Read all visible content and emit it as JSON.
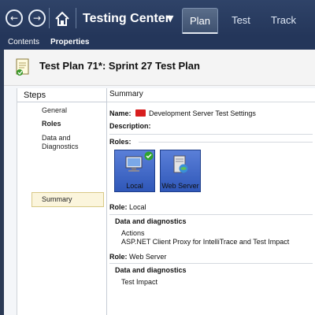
{
  "nav": {
    "back_icon": "back-arrow-icon",
    "forward_icon": "forward-arrow-icon",
    "home_icon": "home-icon",
    "app_title": "Testing Center",
    "dropdown_glyph": "▼",
    "tabs": [
      {
        "label": "Plan",
        "active": true
      },
      {
        "label": "Test",
        "active": false
      },
      {
        "label": "Track",
        "active": false
      }
    ]
  },
  "subnav": {
    "items": [
      {
        "label": "Contents",
        "active": false
      },
      {
        "label": "Properties",
        "active": true
      }
    ]
  },
  "header": {
    "title": "Test Plan 71*: Sprint 27 Test Plan",
    "icon": "test-plan-icon"
  },
  "steps": {
    "heading": "Steps",
    "items": [
      {
        "label": "General",
        "bold": false
      },
      {
        "label": "Roles",
        "bold": true
      },
      {
        "label": "Data and\nDiagnostics",
        "bold": false
      },
      {
        "label": "Summary",
        "bold": false,
        "selected": true
      }
    ]
  },
  "summary": {
    "heading": "Summary",
    "name_label": "Name:",
    "name_value": "Development Server Test Settings",
    "description_label": "Description:",
    "roles_label": "Roles:",
    "roles": [
      {
        "label": "Local",
        "icon": "computer-icon",
        "checked": true
      },
      {
        "label": "Web Server",
        "icon": "server-icon",
        "checked": false
      }
    ],
    "role_local_label": "Role:",
    "role_local_value": "Local",
    "dd1_heading": "Data and diagnostics",
    "dd1_items": [
      "Actions",
      "ASP.NET Client Proxy for IntelliTrace and Test Impact"
    ],
    "role_web_label": "Role:",
    "role_web_value": "Web Server",
    "dd2_heading": "Data and diagnostics",
    "dd2_items": [
      "Test Impact"
    ]
  },
  "colors": {
    "topbar": "#2b3a55",
    "role_tile": "#3a64c8",
    "selected_step": "#fbf5dc",
    "flag_red": "#d81e1e"
  }
}
